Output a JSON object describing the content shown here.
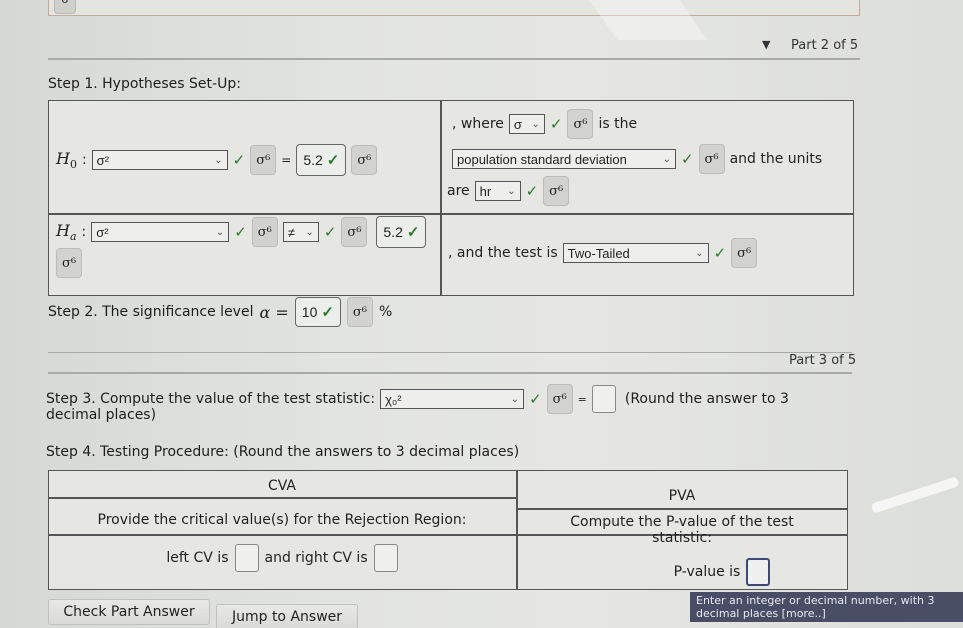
{
  "part2": {
    "label": "Part 2 of 5",
    "collapse_icon": "triangle-down-icon",
    "step1_title": "Step 1. Hypotheses Set-Up:",
    "h0": {
      "symbol": "H",
      "subscript": "0",
      "colon": ":",
      "param_select": "σ²",
      "operator": "=",
      "value": "5.2"
    },
    "ha": {
      "symbol": "H",
      "subscript": "a",
      "colon": ":",
      "param_select": "σ²",
      "operator_select": "≠",
      "value": "5.2"
    },
    "where_text": ", where",
    "where_select": "σ",
    "is_the_text": "is the",
    "description_select": "population standard deviation",
    "units_text": "and the units",
    "are_text": "are",
    "units_select": "hr",
    "test_text": ", and the test is",
    "test_select": "Two-Tailed",
    "step2_text": "Step 2. The significance level",
    "alpha_symbol": "α =",
    "alpha_value": "10",
    "percent": "%"
  },
  "part3": {
    "label": "Part 3 of 5",
    "step3_text": "Step 3. Compute the value of the test statistic:",
    "stat_select": "χ₀²",
    "equals": "=",
    "stat_value": "",
    "round_text_a": "(Round the answer to 3",
    "round_text_b": "decimal places)",
    "step4_text": "Step 4. Testing Procedure: (Round the answers to 3 decimal places)",
    "table": {
      "cva_header": "CVA",
      "pva_header": "PVA",
      "cva_prompt": "Provide the critical value(s) for the Rejection Region:",
      "pva_prompt_a": "Compute the P-value of the test",
      "pva_prompt_b": "statistic:",
      "left_cv_label": "left CV is",
      "left_cv_value": "",
      "right_cv_label": "and right CV is",
      "right_cv_value": "",
      "pvalue_label": "P-value is",
      "pvalue_value": ""
    }
  },
  "buttons": {
    "check_part": "Check Part Answer",
    "jump": "Jump to Answer"
  },
  "tooltip": {
    "line1": "Enter an integer or decimal number, with 3",
    "line2": "decimal places [more..]"
  },
  "icons": {
    "key": "σ⁶",
    "check": "✓",
    "chevron": "⌄"
  },
  "colors": {
    "check_green": "#2a7a2a",
    "tooltip_bg": "#4a4d66"
  }
}
